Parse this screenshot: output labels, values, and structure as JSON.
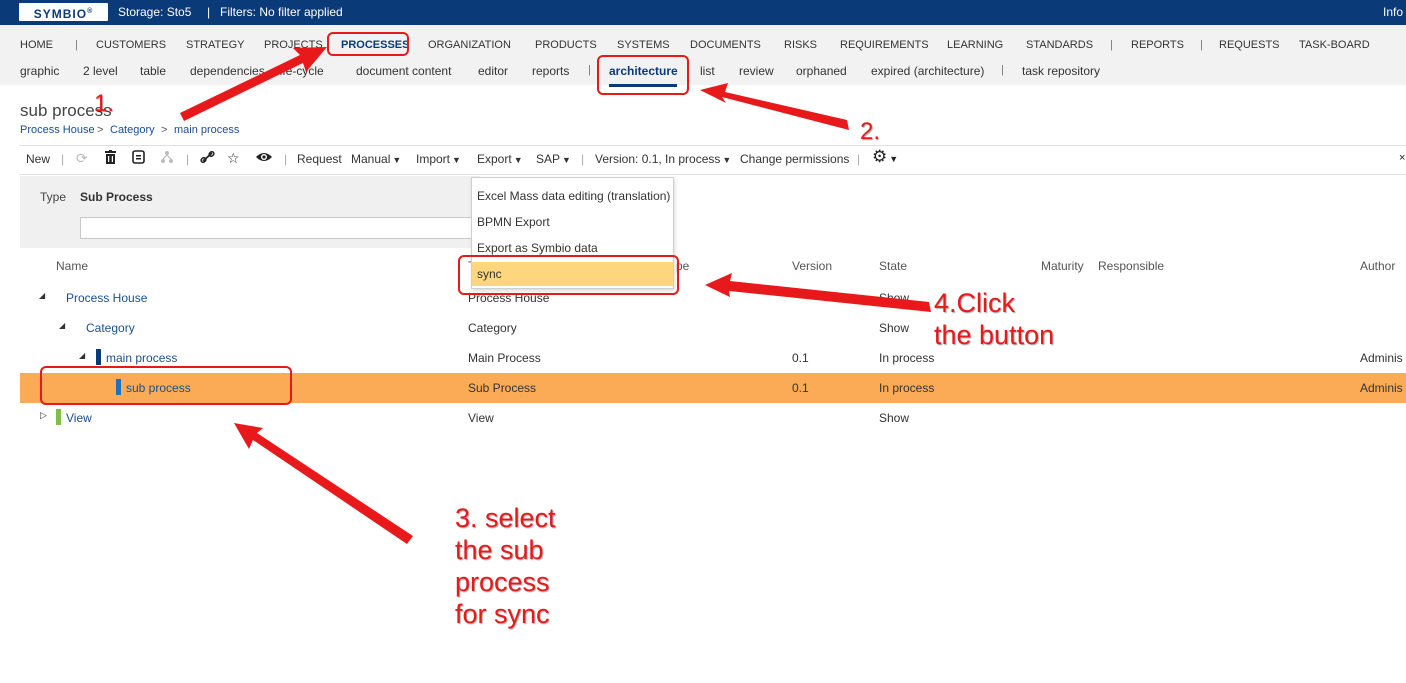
{
  "topbar": {
    "logo": "SYMBIO",
    "storage": "Storage:  Sto5",
    "sep": "|",
    "filters": "Filters: No filter applied",
    "info": "Info"
  },
  "nav": {
    "items": [
      "HOME",
      "CUSTOMERS",
      "STRATEGY",
      "PROJECTS",
      "PROCESSES",
      "ORGANIZATION",
      "PRODUCTS",
      "SYSTEMS",
      "DOCUMENTS",
      "RISKS",
      "REQUIREMENTS",
      "LEARNING",
      "STANDARDS",
      "REPORTS",
      "REQUESTS",
      "TASK-BOARD"
    ],
    "separator": "|",
    "active": "PROCESSES"
  },
  "subnav": {
    "items": [
      "graphic",
      "2 level",
      "table",
      "dependencies",
      "life-cycle",
      "document content",
      "editor",
      "reports",
      "architecture",
      "list",
      "review",
      "orphaned",
      "expired (architecture)",
      "task repository"
    ],
    "separator": "|",
    "active": "architecture"
  },
  "page": {
    "title": "sub process",
    "breadcrumb": [
      "Process House",
      "Category",
      "main process"
    ],
    "crumb_sep": ">"
  },
  "toolbar": {
    "new": "New",
    "request": "Request",
    "manual": "Manual",
    "import": "Import",
    "export": "Export",
    "sap": "SAP",
    "version": "Version: 0.1, In process",
    "change_permissions": "Change permissions",
    "sep": "|",
    "icons": [
      "refresh-icon",
      "delete-icon",
      "export-doc-icon",
      "hierarchy-icon",
      "link-icon",
      "favorite-icon",
      "watch-icon",
      "settings-icon"
    ]
  },
  "filter": {
    "type_label": "Type",
    "type_value": "Sub Process",
    "input_value": ""
  },
  "table": {
    "headers": {
      "name": "Name",
      "type": "T",
      "type_tail": "pe",
      "version": "Version",
      "state": "State",
      "maturity": "Maturity",
      "responsible": "Responsible",
      "author": "Author"
    },
    "rows": [
      {
        "name": "Process House",
        "type": "Process House",
        "version": "",
        "state": "Show",
        "author": ""
      },
      {
        "name": "Category",
        "type": "Category",
        "version": "",
        "state": "Show",
        "author": ""
      },
      {
        "name": "main process",
        "type": "Main Process",
        "version": "0.1",
        "state": "In process",
        "author": "Adminis"
      },
      {
        "name": "sub process",
        "type": "Sub Process",
        "version": "0.1",
        "state": "In process",
        "author": "Adminis"
      },
      {
        "name": "View",
        "type": "View",
        "version": "",
        "state": "Show",
        "author": ""
      }
    ],
    "expander_icons": [
      "collapse-icon",
      "expand-icon"
    ]
  },
  "export_menu": {
    "items": [
      "Excel Mass data editing (translation)",
      "BPMN Export",
      "Export as Symbio data",
      "sync"
    ],
    "highlighted": "sync"
  },
  "annotations": {
    "step1": "1.",
    "step2": "2.",
    "step3_lines": [
      "3. select",
      "the sub",
      "process",
      "for sync"
    ],
    "step4_lines": [
      "4.Click",
      "the button"
    ]
  },
  "colors": {
    "topbar": "#0b3a78",
    "selected_row": "#fbab55",
    "menu_highlight": "#fdd67e",
    "annotation_red": "#e8191b",
    "link": "#1b4f8c",
    "view_marker": "#7cc04a"
  }
}
